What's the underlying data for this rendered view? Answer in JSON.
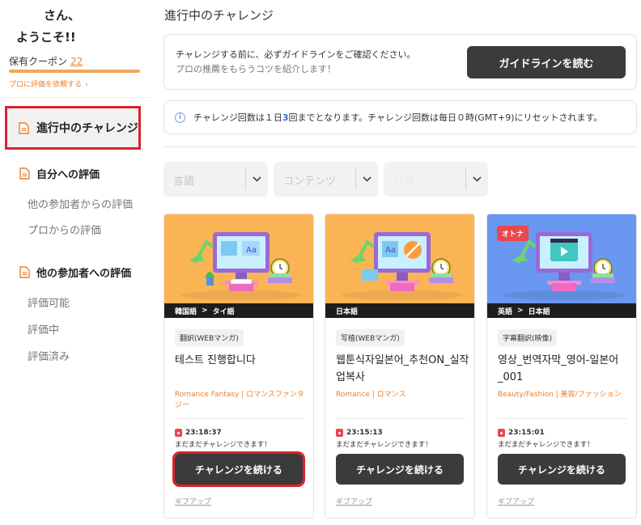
{
  "sidebar": {
    "greeting": "さん、",
    "welcome": "ようこそ!!",
    "coupon_label": "保有クーポン",
    "coupon_count": "22",
    "request_link": "プロに評価を依頼する",
    "nav_active": "進行中のチャレンジ",
    "sections": [
      {
        "title": "自分への評価",
        "items": [
          "他の参加者からの評価",
          "プロからの評価"
        ]
      },
      {
        "title": "他の参加者への評価",
        "items": [
          "評価可能",
          "評価中",
          "評価済み"
        ]
      }
    ]
  },
  "main": {
    "title": "進行中のチャレンジ",
    "guide": {
      "line1": "チャレンジする前に、必ずガイドラインをご確認ください。",
      "line2": "プロの推薦をもらうコツを紹介します！",
      "button": "ガイドラインを読む"
    },
    "notice": {
      "before": "チャレンジ回数は１日",
      "highlight": "3",
      "after": "回までとなります。チャレンジ回数は毎日０時(GMT+9)にリセットされます。"
    },
    "filters": [
      {
        "placeholder": "言語"
      },
      {
        "placeholder": "コンテンツ"
      },
      {
        "placeholder": "分野"
      }
    ]
  },
  "cards": [
    {
      "lang_from": "韓国語",
      "lang_to": "タイ語",
      "lang_arrow": ">",
      "tag": "翻訳(WEBマンガ)",
      "title": "테스트 진행합니다",
      "genre": "Romance Fantasy | ロマンスファンタジー",
      "timer": "23:18:37",
      "note": "まだまだチャレンジできます！",
      "button": "チャレンジを続ける",
      "giveup": "ギブアップ",
      "thumb_bg": "#fbb454",
      "adult_badge": ""
    },
    {
      "lang_from": "日本語",
      "lang_to": "",
      "lang_arrow": "",
      "tag": "写植(WEBマンガ)",
      "title": "웹툰식자일본어_추천ON_실작업복사",
      "genre": "Romance | ロマンス",
      "timer": "23:15:13",
      "note": "まだまだチャレンジできます！",
      "button": "チャレンジを続ける",
      "giveup": "ギブアップ",
      "thumb_bg": "#fbb454",
      "adult_badge": ""
    },
    {
      "lang_from": "英語",
      "lang_to": "日本語",
      "lang_arrow": ">",
      "tag": "字幕翻訳(映像)",
      "title": "영상_번역자막_영어-일본어_001",
      "genre": "Beauty/Fashion | 美容/ファッション",
      "timer": "23:15:01",
      "note": "まだまだチャレンジできます！",
      "button": "チャレンジを続ける",
      "giveup": "ギブアップ",
      "thumb_bg": "#6a98f0",
      "adult_badge": "オトナ"
    }
  ],
  "colors": {
    "accent": "#e8812f",
    "highlight_border": "#d9232d",
    "dark_button": "#3b3b3b",
    "notice_number": "#2f6fe0"
  },
  "coupon_progress": 1.0
}
